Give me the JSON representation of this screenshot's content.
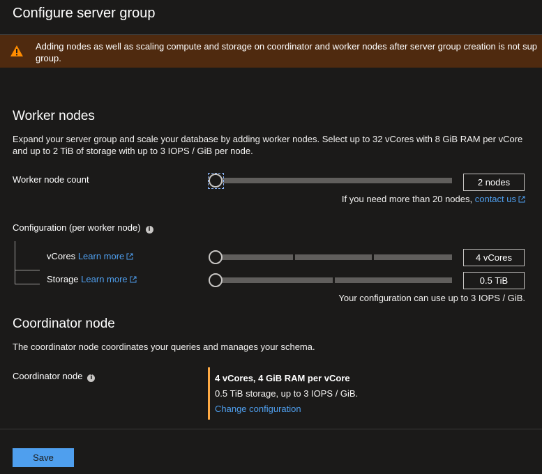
{
  "header": {
    "title": "Configure server group"
  },
  "warning": {
    "line1": "Adding nodes as well as scaling compute and storage on coordinator and worker nodes after server group creation is not sup",
    "line2": "group."
  },
  "worker_nodes": {
    "heading": "Worker nodes",
    "description_line1": "Expand your server group and scale your database by adding worker nodes. Select up to 32 vCores with 8 GiB RAM per vCore",
    "description_line2": "and up to 2 TiB of storage with up to 3 IOPS / GiB per node.",
    "count_label": "Worker node count",
    "count_value": "2 nodes",
    "more_than_text": "If you need more than 20 nodes,",
    "contact_us_label": "contact us",
    "config_label": "Configuration (per worker node)",
    "vcores_label": "vCores",
    "vcores_learn_more": "Learn more",
    "vcores_value": "4 vCores",
    "storage_label": "Storage",
    "storage_learn_more": "Learn more",
    "storage_value": "0.5 TiB",
    "iops_note": "Your configuration can use up to 3 IOPS / GiB."
  },
  "coordinator": {
    "heading": "Coordinator node",
    "description": "The coordinator node coordinates your queries and manages your schema.",
    "label": "Coordinator node",
    "summary_bold": "4 vCores, 4 GiB RAM per vCore",
    "summary_storage": "0.5 TiB storage, up to 3 IOPS / GiB.",
    "change_label": "Change configuration"
  },
  "footer": {
    "save_label": "Save"
  },
  "icons": {
    "warning": "warning-triangle-icon",
    "info": "info-icon",
    "external": "external-link-icon"
  },
  "colors": {
    "accent": "#4f9fee",
    "warning_bg": "#4f2a0f",
    "warning_icon": "#ff8c00",
    "coord_bar": "#ffaa44"
  }
}
